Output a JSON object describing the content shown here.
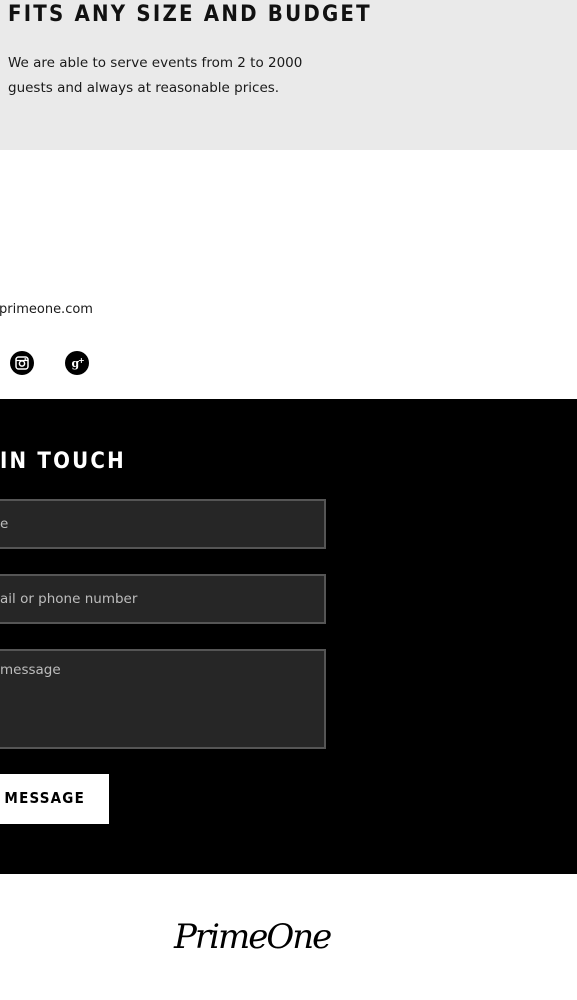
{
  "feature": {
    "title": "FITS ANY SIZE AND BUDGET",
    "text": "We are able to serve events from 2 to 2000 guests and always at reasonable prices."
  },
  "contact_info": {
    "email_fragment": "primeone.com"
  },
  "social": {
    "icons": [
      "instagram-icon",
      "google-plus-icon"
    ]
  },
  "contact_form": {
    "title_fragment": "IN TOUCH",
    "name_placeholder": "e",
    "contact_placeholder": "ail or phone number",
    "message_placeholder": "message",
    "send_label": "ND MESSAGE"
  },
  "footer": {
    "logo_text": "PrimeOne"
  },
  "colors": {
    "feature_bg": "#eaeaea",
    "contact_bg": "#000000",
    "field_bg": "#262626",
    "field_border": "#555555"
  }
}
